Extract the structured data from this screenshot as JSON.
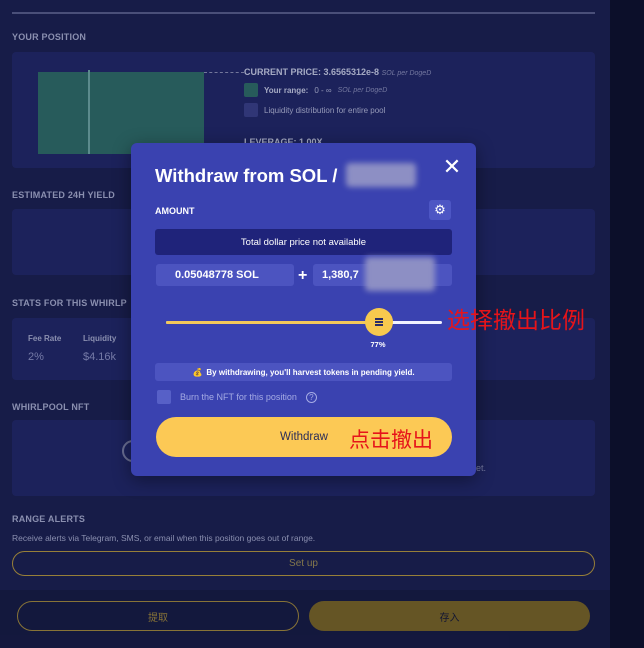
{
  "background": {
    "your_position": {
      "title": "YOUR POSITION",
      "current_price_label": "CURRENT PRICE: 3.6565312e-8",
      "current_price_unit": "SOL per DogeD",
      "your_range_label": "Your range:",
      "your_range_value": "0 - ∞",
      "your_range_unit": "SOL per DogeD",
      "liquidity_label": "Liquidity distribution for entire pool",
      "leverage": "LEVERAGE: 1.00X"
    },
    "estimated_yield": {
      "title": "ESTIMATED 24H YIELD"
    },
    "stats": {
      "title": "STATS FOR THIS WHIRLP",
      "fee_rate_label": "Fee Rate",
      "fee_rate_value": "2%",
      "liquidity_label": "Liquidity",
      "liquidity_value": "$4.16k"
    },
    "whirlpool_nft": {
      "title": "WHIRLPOOL NFT",
      "trailing_text": "et."
    },
    "range_alerts": {
      "title": "RANGE ALERTS",
      "description": "Receive alerts via Telegram, SMS, or email when this position goes out of range.",
      "setup_button": "Set up"
    },
    "footer": {
      "left_button": "提取",
      "right_button": "存入"
    }
  },
  "modal": {
    "title": "Withdraw from SOL /",
    "amount_label": "AMOUNT",
    "settings_icon": "gear-icon",
    "close_icon": "close-icon",
    "total_price_text": "Total dollar price not available",
    "sol_amount": "0.05048778 SOL",
    "plus": "+",
    "other_amount": "1,380,7",
    "slider_percent_value": 77,
    "slider_percent_label": "77%",
    "info_icon": "money-bag-icon",
    "info_text": "By withdrawing, you'll harvest tokens in pending yield.",
    "burn_label": "Burn the NFT for this position",
    "withdraw_button": "Withdraw"
  },
  "annotations": {
    "slider_note": "选择撤出比例",
    "button_note": "点击撤出"
  },
  "colors": {
    "modal_bg": "#3a42b0",
    "accent_yellow": "#fcc955",
    "annotation_red": "#e6141a",
    "page_bg": "#1b2052"
  }
}
